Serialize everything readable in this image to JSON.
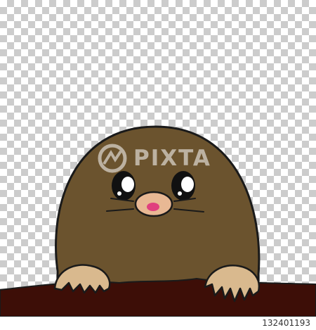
{
  "watermark": {
    "text": "PIXTA",
    "logo_icon": "pixta-logo-icon"
  },
  "footer": {
    "image_id": "132401193"
  },
  "illustration": {
    "subject": "mole",
    "colors": {
      "body": "#6b532e",
      "outline": "#1a1a1a",
      "paw": "#d9b98e",
      "nose": "#e8b894",
      "nostril": "#e0407e",
      "soil": "#3d0e07"
    }
  }
}
